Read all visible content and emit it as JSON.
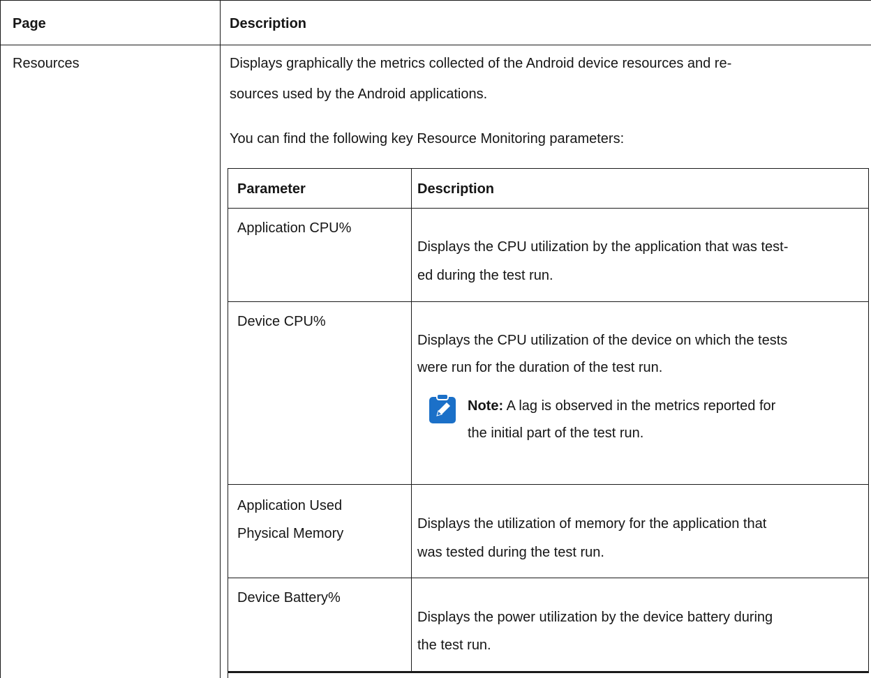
{
  "outer_table": {
    "headers": {
      "page": "Page",
      "description": "Description"
    },
    "row": {
      "page": "Resources",
      "description_line1": "Displays graphically the metrics collected of the Android device resources and re-",
      "description_line2": "sources used by the Android applications.",
      "intro": "You can find the following key Resource Monitoring parameters:"
    }
  },
  "inner_table": {
    "headers": {
      "parameter": "Parameter",
      "description": "Description"
    },
    "rows": [
      {
        "parameter_lines": [
          "Application CPU%"
        ],
        "description_lines": [
          "Displays the CPU utilization by the application that was test-",
          "ed during the test run."
        ]
      },
      {
        "parameter_lines": [
          "Device CPU%"
        ],
        "description_lines": [
          "Displays the CPU utilization of the device on which the tests",
          "were run for the duration of the test run."
        ],
        "note": {
          "icon": "note-pencil-icon",
          "label": "Note:",
          "line1": " A lag is observed in the metrics reported for",
          "line2": "the initial part of the test run."
        }
      },
      {
        "parameter_lines": [
          "Application Used",
          "Physical Memory"
        ],
        "description_lines": [
          "Displays the utilization of memory for the application that",
          "was tested during the test run."
        ]
      },
      {
        "parameter_lines": [
          "Device Battery%"
        ],
        "description_lines": [
          "Displays the power utilization by the device battery during",
          "the test run."
        ]
      }
    ]
  },
  "colors": {
    "text": "#161616",
    "border": "#1a1a1a",
    "note_icon": "#1b70c8"
  }
}
